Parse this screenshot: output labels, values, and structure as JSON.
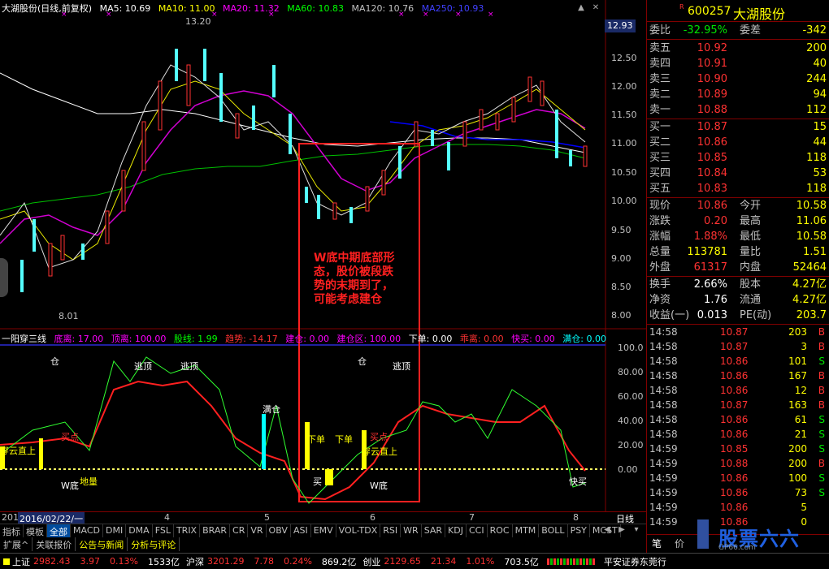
{
  "main_title": {
    "name": "大湖股份(日线,前复权)",
    "ma5": "MA5: 10.69",
    "ma10": "MA10: 11.00",
    "ma20": "MA20: 11.32",
    "ma60": "MA60: 10.83",
    "ma120": "MA120: 10.76",
    "ma250": "MA250: 10.93"
  },
  "price_tag": "12.93",
  "price_axis": [
    "12.50",
    "12.00",
    "11.50",
    "11.00",
    "10.50",
    "10.00",
    "9.50",
    "9.00",
    "8.50",
    "8.00"
  ],
  "high_label": "13.20",
  "low_label": "8.01",
  "annotation": "W底中期底部形态，股价被段跌势的末期到了，可能考虑建仓",
  "indicator_title": {
    "name": "一阳穿三线",
    "bottom": "底离: 17.00",
    "top": "顶离: 100.00",
    "stock_line": "股线: 1.99",
    "trend": "趋势: -14.17",
    "build": "建仓: 0.00",
    "build_zone": "建仓区: 100.00",
    "below": "下单: 0.00",
    "deviate": "乖离: 0.00",
    "fast_buy": "快买: 0.00",
    "full": "满仓: 0.00"
  },
  "ind_axis": [
    "100.0",
    "80.00",
    "60.00",
    "40.00",
    "20.00",
    "0.00"
  ],
  "ind_labels": [
    "仓",
    "逃顶",
    "逃顶",
    "仓",
    "逃顶",
    "满仓",
    "买点",
    "穿云直上",
    "W底",
    "地量",
    "下单",
    "下单",
    "买点",
    "穿云直上",
    "W底",
    "快买",
    "买"
  ],
  "date_axis": {
    "start": "201",
    "cursor": "2016/02/22/一",
    "m4": "4",
    "m5": "5",
    "m6": "6",
    "m7": "7",
    "m8": "8",
    "period": "日线"
  },
  "tabs": [
    "指标",
    "模板",
    "全部",
    "MACD",
    "DMI",
    "DMA",
    "FSL",
    "TRIX",
    "BRAR",
    "CR",
    "VR",
    "OBV",
    "ASI",
    "EMV",
    "VOL-TDX",
    "RSI",
    "WR",
    "SAR",
    "KDJ",
    "CCI",
    "ROC",
    "MTM",
    "BOLL",
    "PSY",
    "MCST"
  ],
  "tabs2": [
    "扩展^",
    "关联报价",
    "公告与新闻",
    "分析与评论"
  ],
  "stock": {
    "code": "600257",
    "name": "大湖股份",
    "marker": "R"
  },
  "wei": {
    "label1": "委比",
    "v1": "-32.95%",
    "label2": "委差",
    "v2": "-342"
  },
  "sells": [
    {
      "label": "卖五",
      "price": "10.92",
      "vol": "200"
    },
    {
      "label": "卖四",
      "price": "10.91",
      "vol": "40"
    },
    {
      "label": "卖三",
      "price": "10.90",
      "vol": "244"
    },
    {
      "label": "卖二",
      "price": "10.89",
      "vol": "94"
    },
    {
      "label": "卖一",
      "price": "10.88",
      "vol": "112"
    }
  ],
  "buys": [
    {
      "label": "买一",
      "price": "10.87",
      "vol": "15"
    },
    {
      "label": "买二",
      "price": "10.86",
      "vol": "44"
    },
    {
      "label": "买三",
      "price": "10.85",
      "vol": "118"
    },
    {
      "label": "买四",
      "price": "10.84",
      "vol": "53"
    },
    {
      "label": "买五",
      "price": "10.83",
      "vol": "118"
    }
  ],
  "quote": [
    {
      "l1": "现价",
      "v1": "10.86",
      "c1": "up",
      "l2": "今开",
      "v2": "10.58",
      "c2": "down"
    },
    {
      "l1": "涨跌",
      "v1": "0.20",
      "c1": "up",
      "l2": "最高",
      "v2": "11.06",
      "c2": "up"
    },
    {
      "l1": "涨幅",
      "v1": "1.88%",
      "c1": "up",
      "l2": "最低",
      "v2": "10.58",
      "c2": "down"
    },
    {
      "l1": "总量",
      "v1": "113781",
      "c1": "yellow",
      "l2": "量比",
      "v2": "1.51",
      "c2": "up"
    },
    {
      "l1": "外盘",
      "v1": "61317",
      "c1": "up",
      "l2": "内盘",
      "v2": "52464",
      "c2": "down"
    }
  ],
  "fund": [
    {
      "l1": "换手",
      "v1": "2.66%",
      "l2": "股本",
      "v2": "4.27亿"
    },
    {
      "l1": "净资",
      "v1": "1.76",
      "l2": "流通",
      "v2": "4.27亿"
    },
    {
      "l1": "收益(一)",
      "v1": "0.013",
      "l2": "PE(动)",
      "v2": "203.7"
    }
  ],
  "ticks": [
    {
      "t": "14:58",
      "p": "10.87",
      "v": "203",
      "bs": "B"
    },
    {
      "t": "14:58",
      "p": "10.87",
      "v": "3",
      "bs": "B"
    },
    {
      "t": "14:58",
      "p": "10.86",
      "v": "101",
      "bs": "S"
    },
    {
      "t": "14:58",
      "p": "10.86",
      "v": "167",
      "bs": "B"
    },
    {
      "t": "14:58",
      "p": "10.86",
      "v": "12",
      "bs": "B"
    },
    {
      "t": "14:58",
      "p": "10.87",
      "v": "163",
      "bs": "B"
    },
    {
      "t": "14:58",
      "p": "10.86",
      "v": "61",
      "bs": "S"
    },
    {
      "t": "14:58",
      "p": "10.86",
      "v": "21",
      "bs": "S"
    },
    {
      "t": "14:59",
      "p": "10.85",
      "v": "200",
      "bs": "S"
    },
    {
      "t": "14:59",
      "p": "10.88",
      "v": "200",
      "bs": "B"
    },
    {
      "t": "14:59",
      "p": "10.86",
      "v": "100",
      "bs": "S"
    },
    {
      "t": "14:59",
      "p": "10.86",
      "v": "73",
      "bs": "S"
    },
    {
      "t": "14:59",
      "p": "10.86",
      "v": "5",
      "bs": ""
    },
    {
      "t": "14:59",
      "p": "10.86",
      "v": "0",
      "bs": ""
    }
  ],
  "status": {
    "sh_label": "上证",
    "sh_val": "2982.43",
    "sh_chg": "3.97",
    "sh_pct": "0.13%",
    "sh_amt": "1533亿",
    "sz_label": "沪深",
    "sz_val": "3201.29",
    "sz_chg": "7.78",
    "sz_pct": "0.24%",
    "sz_amt": "869.2亿",
    "cy_label": "创业",
    "cy_val": "2129.65",
    "cy_chg": "21.34",
    "cy_pct": "1.01%",
    "cy_amt": "703.5亿",
    "broker": "平安证券东莞行"
  },
  "watermark": {
    "brand": "股票六六",
    "site": "GP66.com"
  },
  "panel_tabs": [
    "笔",
    "价"
  ]
}
